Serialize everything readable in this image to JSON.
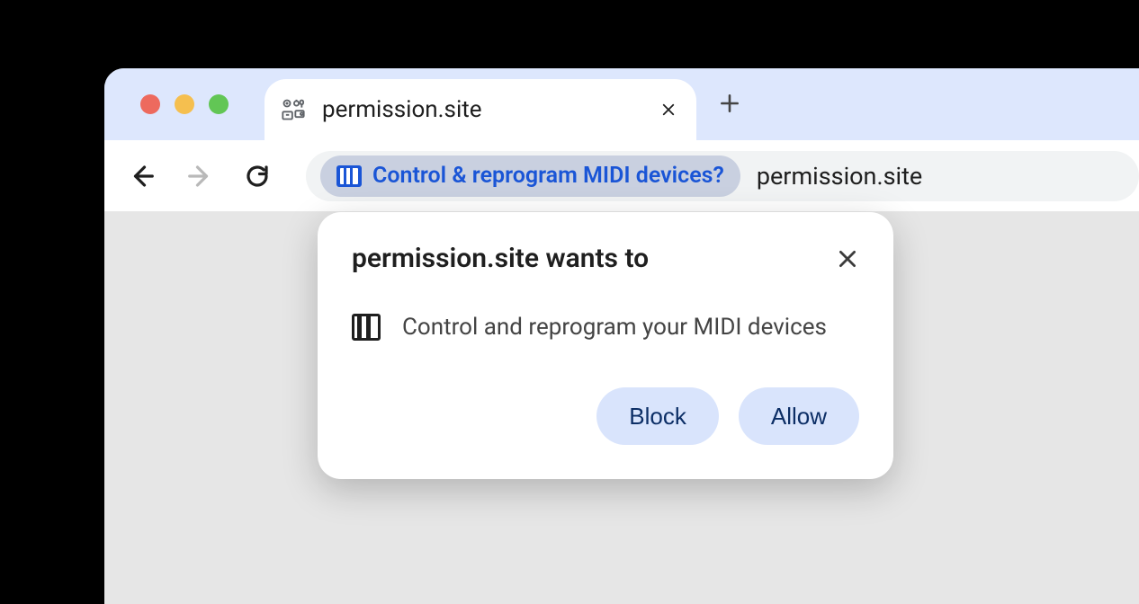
{
  "tab": {
    "title": "permission.site"
  },
  "omnibox": {
    "chip_label": "Control & reprogram MIDI devices?",
    "url": "permission.site"
  },
  "popup": {
    "title": "permission.site wants to",
    "permission_text": "Control and reprogram your MIDI devices",
    "block_label": "Block",
    "allow_label": "Allow"
  }
}
